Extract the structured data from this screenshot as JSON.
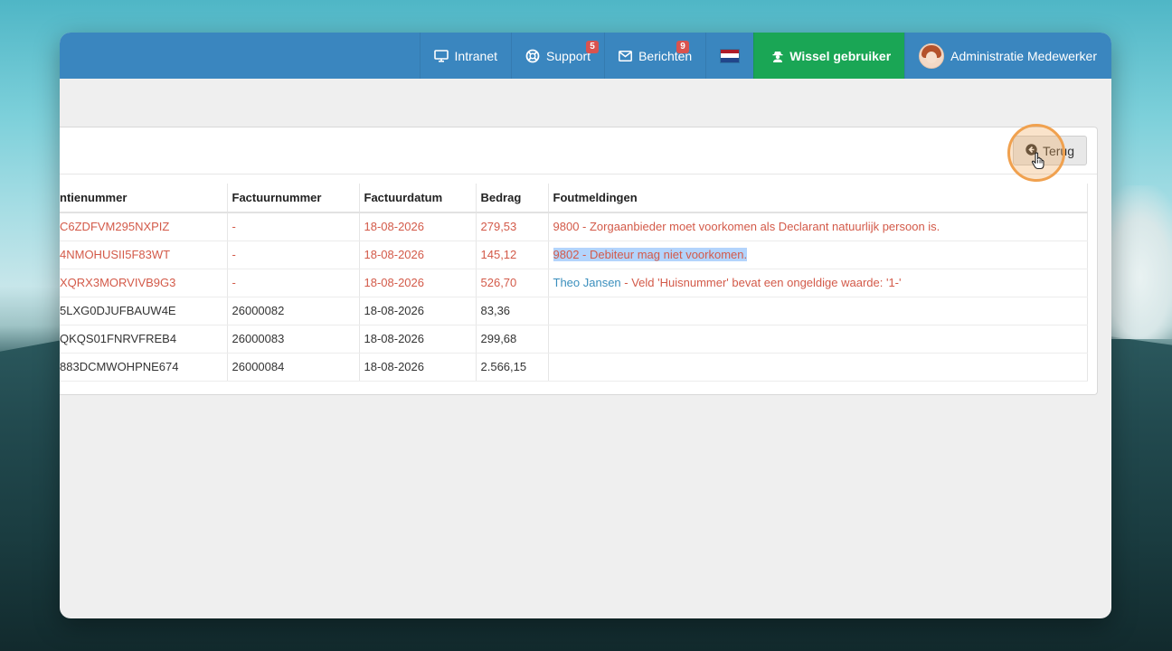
{
  "topbar": {
    "intranet_label": "Intranet",
    "support_label": "Support",
    "support_badge": "5",
    "messages_label": "Berichten",
    "messages_badge": "9",
    "switch_user_label": "Wissel gebruiker",
    "user_name": "Administratie Medewerker"
  },
  "toolbar": {
    "back_label": "Terug"
  },
  "table": {
    "headers": [
      "ntienummer",
      "Factuurnummer",
      "Factuurdatum",
      "Bedrag",
      "Foutmeldingen"
    ],
    "rows": [
      {
        "ref": "C6ZDFVM295NXPIZ",
        "invoice": "-",
        "date": "18-08-2026",
        "amount": "279,53",
        "error": "9800 - Zorgaanbieder moet voorkomen als Declarant natuurlijk persoon is."
      },
      {
        "ref": "4NMOHUSII5F83WT",
        "invoice": "-",
        "date": "18-08-2026",
        "amount": "145,12",
        "error": "9802 - Debiteur mag niet voorkomen."
      },
      {
        "ref": "XQRX3MORVIVB9G3",
        "invoice": "-",
        "date": "18-08-2026",
        "amount": "526,70",
        "error_link": "Theo Jansen",
        "error": " - Veld 'Huisnummer' bevat een ongeldige waarde: '1-'"
      },
      {
        "ref": "5LXG0DJUFBAUW4E",
        "invoice": "26000082",
        "date": "18-08-2026",
        "amount": "83,36",
        "error": ""
      },
      {
        "ref": "QKQS01FNRVFREB4",
        "invoice": "26000083",
        "date": "18-08-2026",
        "amount": "299,68",
        "error": ""
      },
      {
        "ref": "883DCMWOHPNE674",
        "invoice": "26000084",
        "date": "18-08-2026",
        "amount": "2.566,15",
        "error": ""
      }
    ]
  },
  "colors": {
    "topbar": "#3a86bf",
    "switch_user": "#1aa655",
    "error_text": "#d35a49",
    "link_text": "#3b8fbd",
    "badge": "#d9534f",
    "highlight_ring": "#f0a14f"
  },
  "icons": [
    "monitor-icon",
    "lifebuoy-icon",
    "envelope-icon",
    "dutch-flag-icon",
    "user-secret-icon",
    "avatar",
    "circle-arrow-left-icon",
    "hand-pointer-icon"
  ]
}
